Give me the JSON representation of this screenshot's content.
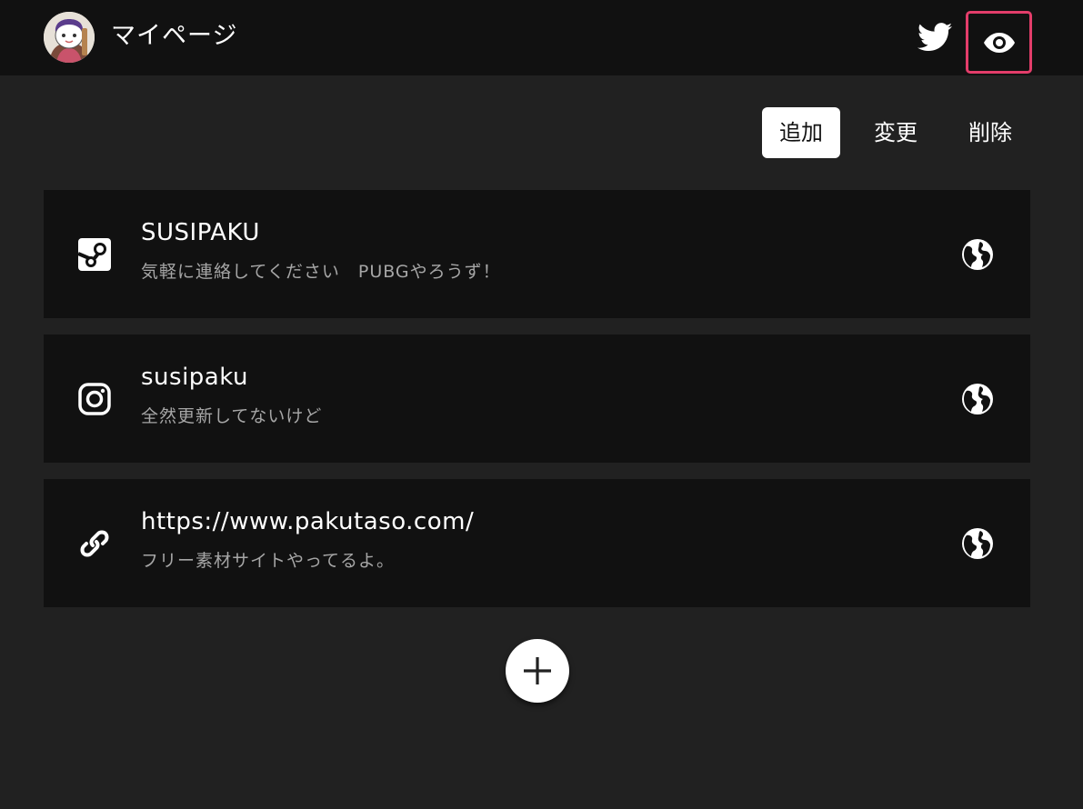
{
  "header": {
    "title": "マイページ",
    "avatar_icon": "avatar-character-icon",
    "twitter_icon": "twitter-bird-icon",
    "view_icon": "eye-icon",
    "highlight_color": "#e33d6a"
  },
  "toolbar": {
    "add_label": "追加",
    "change_label": "変更",
    "delete_label": "削除"
  },
  "links": [
    {
      "icon": "steam-icon",
      "title": "SUSIPAKU",
      "description": "気軽に連絡してください　PUBGやろうず！",
      "visibility_icon": "globe-icon"
    },
    {
      "icon": "instagram-icon",
      "title": "susipaku",
      "description": "全然更新してないけど",
      "visibility_icon": "globe-icon"
    },
    {
      "icon": "link-icon",
      "title": "https://www.pakutaso.com/",
      "description": "フリー素材サイトやってるよ。",
      "visibility_icon": "globe-icon"
    }
  ],
  "fab": {
    "icon": "plus-icon"
  },
  "colors": {
    "background": "#212121",
    "header_background": "#111111",
    "card_background": "#111111",
    "secondary_text": "#a6a6a6"
  }
}
